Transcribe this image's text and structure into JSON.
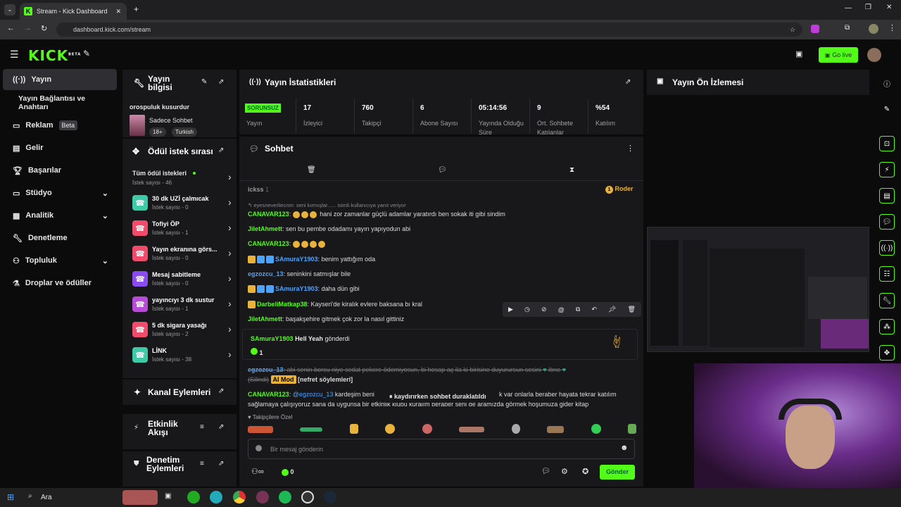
{
  "browser": {
    "tab_title": "Stream - Kick Dashboard",
    "url": "dashboard.kick.com/stream"
  },
  "topbar": {
    "logo": "KICK",
    "logo_sup": "BETA",
    "go_live": "Go live"
  },
  "nav": {
    "items": [
      {
        "label": "Yayın"
      },
      {
        "label": "Yayın Bağlantısı ve Anahtarı"
      },
      {
        "label": "Reklam",
        "badge": "Beta"
      },
      {
        "label": "Gelir"
      },
      {
        "label": "Başarılar"
      },
      {
        "label": "Stüdyo"
      },
      {
        "label": "Analitik"
      },
      {
        "label": "Denetleme"
      },
      {
        "label": "Topluluk"
      },
      {
        "label": "Droplar ve ödüller"
      }
    ]
  },
  "stream_info": {
    "title": "Yayın bilgisi",
    "stream_title": "orospuluk kusurdur",
    "category": "Sadece Sohbet",
    "tags": [
      "18+",
      "Turkish"
    ]
  },
  "rewards": {
    "title": "Ödül istek sırası",
    "all": "Tüm ödül istekleri",
    "all_count": "İstek sayısı - 46",
    "items": [
      {
        "name": "30 dk UZİ çalmıcak",
        "count": "İstek sayısı - 0",
        "color": "#3ec9a7"
      },
      {
        "name": "Tofiyi ÖP",
        "count": "İstek sayısı - 1",
        "color": "#f04b6a"
      },
      {
        "name": "Yayın ekranına görs...",
        "count": "İstek sayısı - 0",
        "color": "#f04b6a"
      },
      {
        "name": "Mesaj sabitleme",
        "count": "İstek sayısı - 0",
        "color": "#8a4bf0"
      },
      {
        "name": "yayıncıyı 3 dk sustur",
        "count": "İstek sayısı - 1",
        "color": "#b84bd8"
      },
      {
        "name": "5 dk sigara yasağı",
        "count": "İstek sayısı - 2",
        "color": "#f04b6a"
      },
      {
        "name": "LİNK",
        "count": "İstek sayısı - 38",
        "color": "#3ec9a7"
      }
    ]
  },
  "channel_actions": {
    "title": "Kanal Eylemleri"
  },
  "activity": {
    "title": "Etkinlik Akışı"
  },
  "mod_actions": {
    "title": "Denetim Eylemleri"
  },
  "stats": {
    "title": "Yayın İstatistikleri",
    "items": [
      {
        "value": "SORUNSUZ",
        "label": "Yayın"
      },
      {
        "value": "17",
        "label": "İzleyici"
      },
      {
        "value": "760",
        "label": "Takipçi"
      },
      {
        "value": "6",
        "label": "Abone Sayısı"
      },
      {
        "value": "05:14:56",
        "label": "Yayında Olduğu Süre"
      },
      {
        "value": "9",
        "label": "Ort. Sohbete Katılanlar"
      },
      {
        "value": "%54",
        "label": "Katılım"
      }
    ]
  },
  "preview": {
    "title": "Yayın Ön İzlemesi"
  },
  "chat": {
    "title": "Sohbet",
    "pinned_user": "ickss",
    "pinned_num": "1",
    "role": "Roder",
    "reply_hint": "eyesneverliecnm: seni kırmışlar...... isimli kullanıcıya yanıt veriyor",
    "messages": [
      {
        "user": "CANAVAR123",
        "cls": "u-g",
        "text": " hani zor zamanlar güçlü adamlar yaratırdı ben sokak iti gibi sindim",
        "emotes": 3
      },
      {
        "user": "JiletAhmett",
        "cls": "u-g",
        "text": " sen bu pembe odadamı yayın yapıyodun abi",
        "emotes": 0
      },
      {
        "user": "CANAVAR123",
        "cls": "u-g",
        "text": "",
        "emotes": 4
      },
      {
        "user": "SAmuraY1903",
        "cls": "u-b",
        "text": " benim yattığım oda",
        "emotes": 0,
        "badges": 3
      },
      {
        "user": "egzozcu_13",
        "cls": "u-b",
        "text": " seninkini satmışlar bile",
        "emotes": 0
      },
      {
        "user": "SAmuraY1903",
        "cls": "u-b",
        "text": " daha dün gibi",
        "emotes": 0,
        "badges": 3
      },
      {
        "user": "DarbeliMatkap38",
        "cls": "u-g",
        "text": " Kayseri'de kiralık evlere baksana bı kral",
        "emotes": 0,
        "badges": 1
      },
      {
        "user": "JiletAhmett",
        "cls": "u-g",
        "text": " başakşehire gitmek çok zor la nasıl gittiniz",
        "emotes": 0
      }
    ],
    "gift_user": "SAmuraY1903",
    "gift_text": "Hell Yeah",
    "gift_verb": "gönderdi",
    "gift_count": "1",
    "deleted_user": "egzozcu_13",
    "deleted_text": "abi senin borcu niye sedat pekere ödemiyosun, bi hesap aç ila ki birisine duyurursun sesini",
    "deleted_tail": "ibne",
    "deleted_tag": "(Silindi)",
    "ai_mod": "AI Mod",
    "ai_reason": "[nefret söylemleri]",
    "last_user": "CANAVAR123",
    "last_mention": "@egzozcu_13",
    "last_text1": "kardeşim beni",
    "last_text1b": "k var onlarla beraber hayata tekrar katılım",
    "last_text2": "sağlamaya çalışıyoruz sana da uygunsa bir etkinlik klübü kuralım beraber seni de aramızda görmek hoşumuza gider kitap",
    "paused": "kaydırırken sohbet duraklatıldı",
    "emote_section": "Takipçilere Özel",
    "placeholder": "Bir mesaj gönderin",
    "points": "0",
    "send": "Gönder"
  },
  "taskbar": {
    "search": "Ara"
  }
}
